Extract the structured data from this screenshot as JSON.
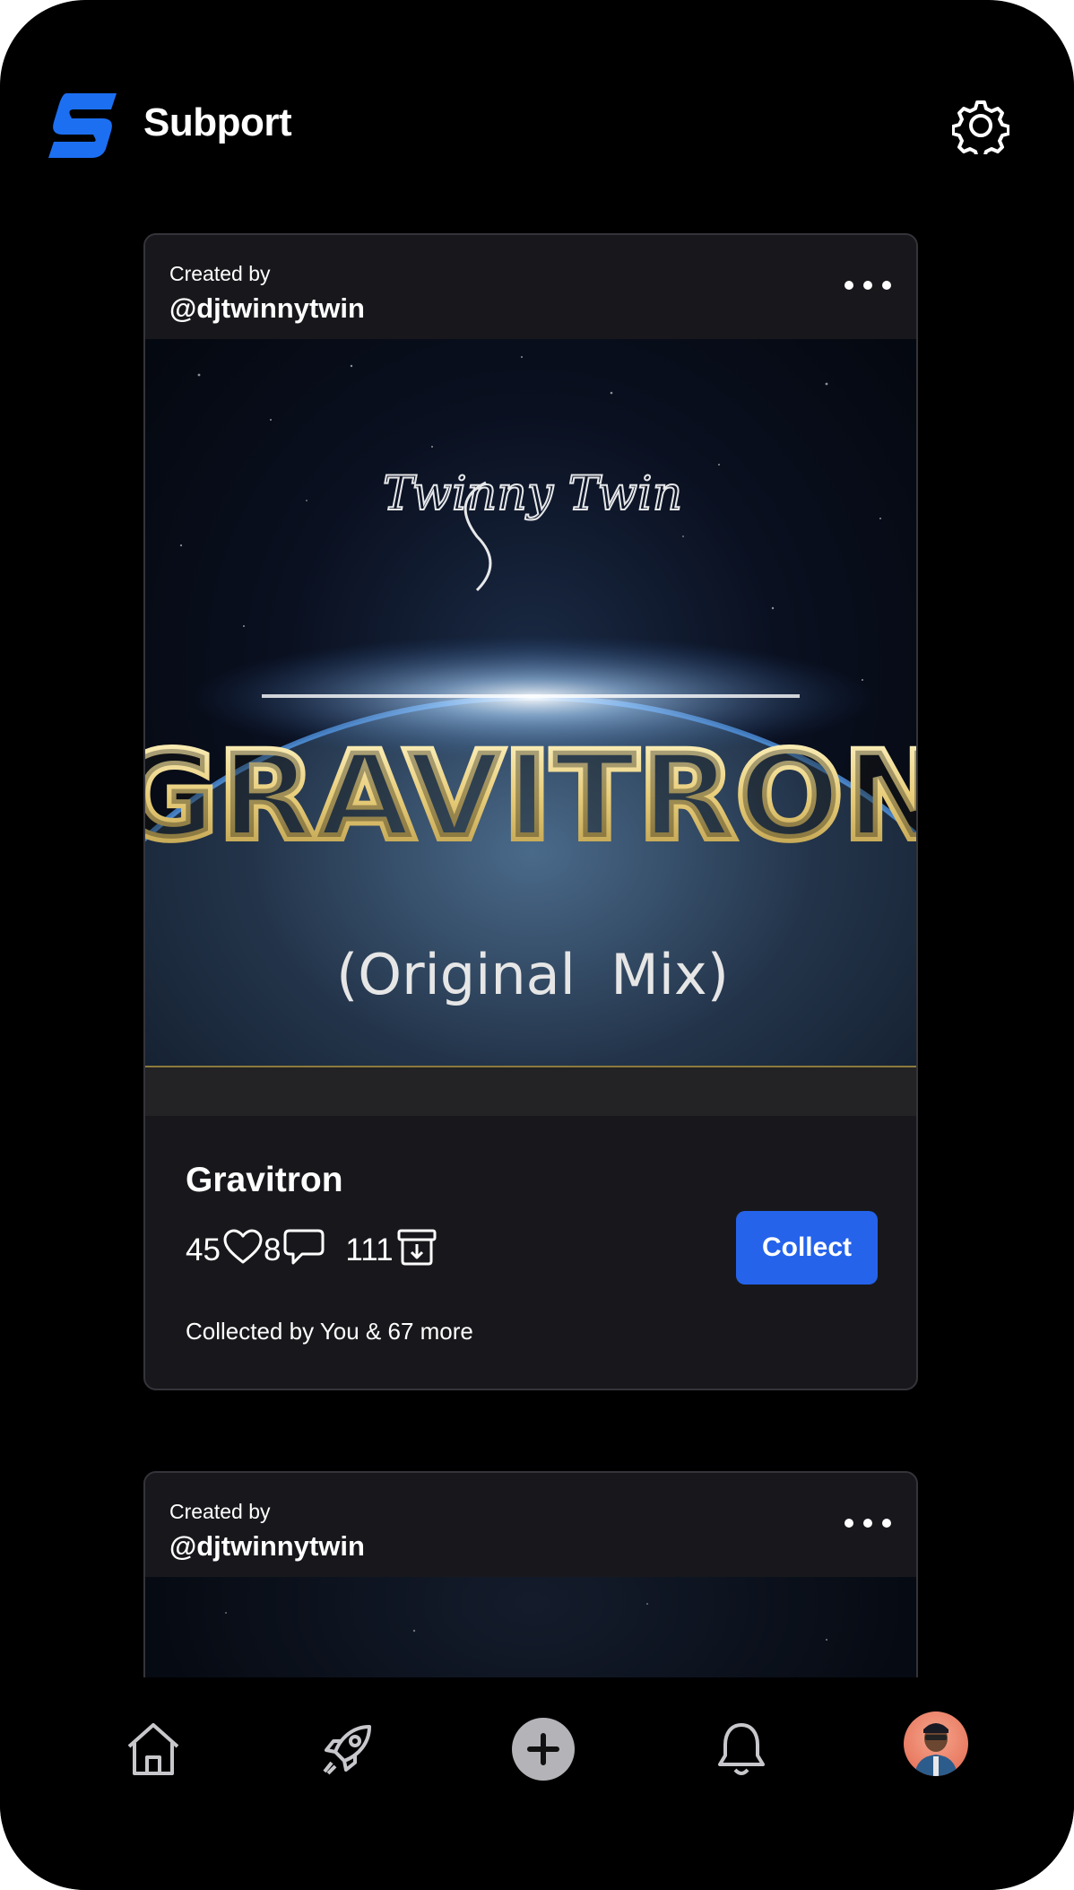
{
  "app": {
    "title": "Subport"
  },
  "icons": {
    "settings": "gear-icon",
    "more": "more-dots-icon",
    "like": "heart-icon",
    "comment": "comment-icon",
    "collect_count": "archive-download-icon",
    "home": "home-icon",
    "discover": "rocket-icon",
    "create": "plus-circle-icon",
    "notifications": "bell-icon"
  },
  "colors": {
    "accent": "#2563eb",
    "logo": "#1d6ff2",
    "card_bg": "#18181c"
  },
  "feed": [
    {
      "created_by_label": "Created by",
      "creator": "@djtwinnytwin",
      "artwork": {
        "logo_text": "Twinny Twin",
        "title_text": "GRAVITRON",
        "subtitle_text": "(Original  Mix)"
      },
      "title": "Gravitron",
      "likes": "45",
      "comments": "8",
      "collects": "111",
      "collect_label": "Collect",
      "collected_by": "Collected by You & 67 more"
    },
    {
      "created_by_label": "Created by",
      "creator": "@djtwinnytwin"
    }
  ]
}
